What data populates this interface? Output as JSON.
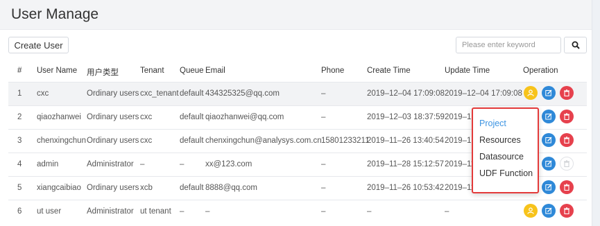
{
  "page": {
    "title": "User Manage"
  },
  "toolbar": {
    "create_label": "Create User",
    "search_placeholder": "Please enter keyword",
    "search_icon": "search-icon"
  },
  "table": {
    "headers": [
      "#",
      "User Name",
      "用户类型",
      "Tenant",
      "Queue",
      "Email",
      "Phone",
      "Create Time",
      "Update Time",
      "Operation"
    ],
    "rows": [
      {
        "index": "1",
        "name": "cxc",
        "type": "Ordinary users",
        "tenant": "cxc_tenant",
        "queue": "default",
        "email": "434325325@qq.com",
        "phone": "–",
        "create": "2019–12–04 17:09:08",
        "update": "2019–12–04 17:09:08"
      },
      {
        "index": "2",
        "name": "qiaozhanwei",
        "type": "Ordinary users",
        "tenant": "cxc",
        "queue": "default",
        "email": "qiaozhanwei@qq.com",
        "phone": "–",
        "create": "2019–12–03 18:37:59",
        "update": "2019–12"
      },
      {
        "index": "3",
        "name": "chenxingchun",
        "type": "Ordinary users",
        "tenant": "cxc",
        "queue": "default",
        "email": "chenxingchun@analysys.com.cn",
        "phone": "15801233211",
        "create": "2019–11–26 13:40:54",
        "update": "2019–12"
      },
      {
        "index": "4",
        "name": "admin",
        "type": "Administrator",
        "tenant": "–",
        "queue": "–",
        "email": "xx@123.com",
        "phone": "–",
        "create": "2019–11–28 15:12:57",
        "update": "2019–11"
      },
      {
        "index": "5",
        "name": "xiangcaibiao",
        "type": "Ordinary users",
        "tenant": "xcb",
        "queue": "default",
        "email": "8888@qq.com",
        "phone": "–",
        "create": "2019–11–26 10:53:42",
        "update": "2019–11"
      },
      {
        "index": "6",
        "name": "ut user",
        "type": "Administrator",
        "tenant": "ut tenant",
        "queue": "–",
        "email": "–",
        "phone": "–",
        "create": "–",
        "update": "–"
      }
    ]
  },
  "dropdown": {
    "items": [
      "Project",
      "Resources",
      "Datasource",
      "UDF Function"
    ],
    "active": "Project"
  },
  "colors": {
    "accent": "#3d94e2",
    "user_btn": "#f7c31b",
    "edit_btn": "#2f89d8",
    "delete_btn": "#e6414d",
    "highlight_border": "#e33a3a"
  }
}
